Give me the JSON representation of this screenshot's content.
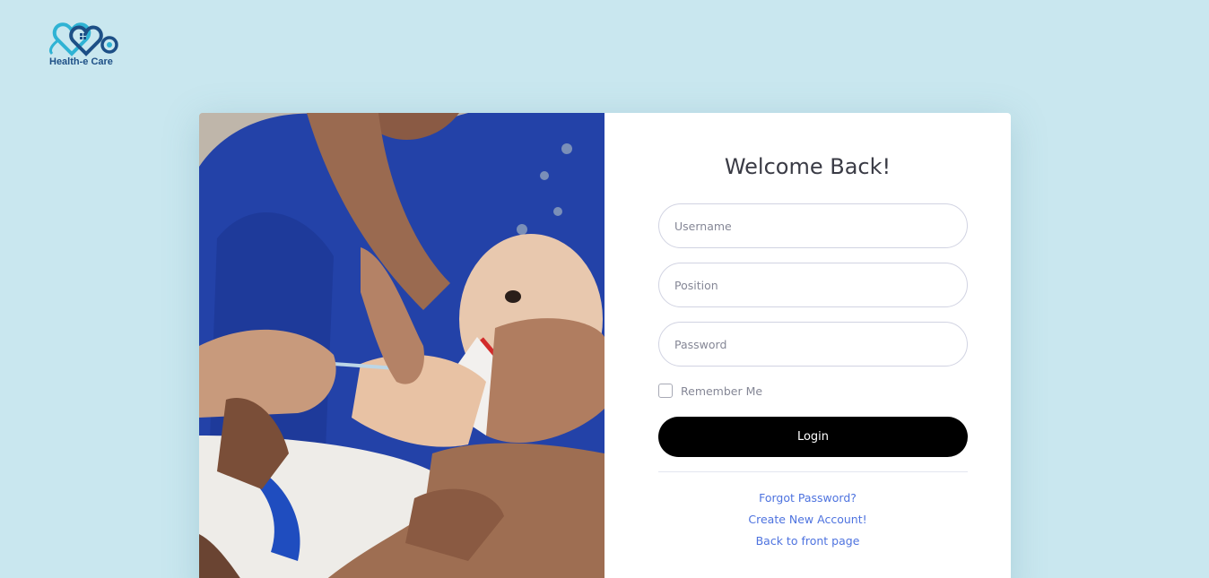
{
  "brand": {
    "logo_text": "Health-e Care"
  },
  "login": {
    "title": "Welcome Back!",
    "username_placeholder": "Username",
    "position_placeholder": "Position",
    "password_placeholder": "Password",
    "remember_label": "Remember Me",
    "login_label": "Login"
  },
  "links": {
    "forgot": "Forgot Password?",
    "create": "Create New Account!",
    "back": "Back to front page"
  },
  "colors": {
    "page_background": "#c9e7ef",
    "button": "#000000",
    "link": "#4e73df",
    "brand_dark": "#1d4f86",
    "brand_light": "#2fb3d4"
  }
}
